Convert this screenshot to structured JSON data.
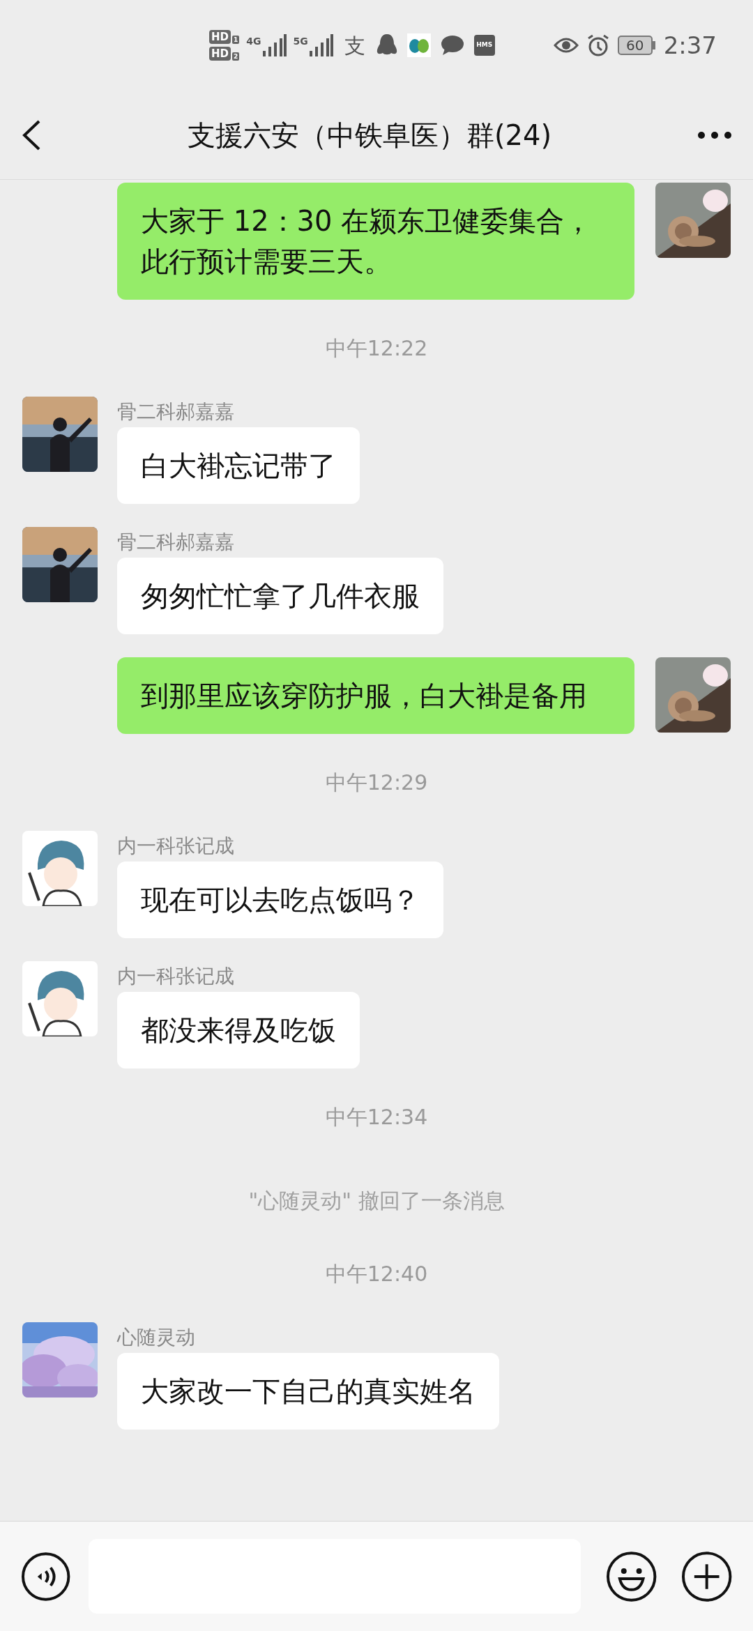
{
  "status_bar": {
    "sim_1": {
      "label": "HD",
      "slot": "1"
    },
    "sim_2": {
      "label": "HD",
      "slot": "2"
    },
    "network_1": "4G",
    "network_2": "5G",
    "app_glyph": "支",
    "hms": "HMS",
    "battery": "60",
    "time": "2:37"
  },
  "header": {
    "title": "支援六安（中铁阜医）群(24)"
  },
  "messages": [
    {
      "kind": "outgoing",
      "text": "大家于 12：30 在颍东卫健委集合，此行预计需要三天。"
    },
    {
      "kind": "time",
      "text": "中午12:22"
    },
    {
      "kind": "incoming",
      "sender": "骨二科郝嘉嘉",
      "text": "白大褂忘记带了"
    },
    {
      "kind": "incoming",
      "sender": "骨二科郝嘉嘉",
      "text": "匆匆忙忙拿了几件衣服"
    },
    {
      "kind": "outgoing",
      "text": "到那里应该穿防护服，白大褂是备用"
    },
    {
      "kind": "time",
      "text": "中午12:29"
    },
    {
      "kind": "incoming",
      "sender": "内一科张记成",
      "text": "现在可以去吃点饭吗？"
    },
    {
      "kind": "incoming",
      "sender": "内一科张记成",
      "text": "都没来得及吃饭"
    },
    {
      "kind": "time",
      "text": "中午12:34"
    },
    {
      "kind": "recall",
      "text": "\"心随灵动\" 撤回了一条消息"
    },
    {
      "kind": "time",
      "text": "中午12:40"
    },
    {
      "kind": "incoming",
      "sender": "心随灵动",
      "text": "大家改一下自己的真实姓名"
    }
  ]
}
